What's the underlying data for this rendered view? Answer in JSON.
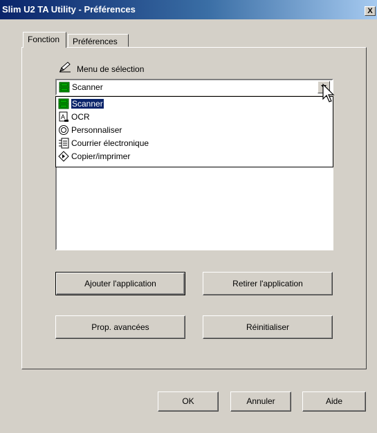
{
  "window": {
    "title": "Slim U2 TA Utility - Préférences",
    "close_label": "X"
  },
  "tabs": [
    {
      "label": "Fonction",
      "active": true
    },
    {
      "label": "Préférences",
      "active": false
    }
  ],
  "selection": {
    "label": "Menu de sélection",
    "current": "Scanner",
    "options": [
      {
        "label": "Scanner",
        "icon": "scanner-icon",
        "selected": true
      },
      {
        "label": "OCR",
        "icon": "ocr-icon",
        "selected": false
      },
      {
        "label": "Personnaliser",
        "icon": "personalize-icon",
        "selected": false
      },
      {
        "label": "Courrier électronique",
        "icon": "email-icon",
        "selected": false
      },
      {
        "label": "Copier/imprimer",
        "icon": "copy-print-icon",
        "selected": false
      }
    ]
  },
  "buttons": {
    "add_app": "Ajouter l'application",
    "remove_app": "Retirer l'application",
    "advanced": "Prop. avancées",
    "reset": "Réinitialiser",
    "ok": "OK",
    "cancel": "Annuler",
    "help": "Aide"
  },
  "colors": {
    "title_start": "#0a246a",
    "title_end": "#a6caf0",
    "face": "#d4d0c8",
    "highlight": "#0a246a",
    "scanner_green": "#00c000"
  }
}
